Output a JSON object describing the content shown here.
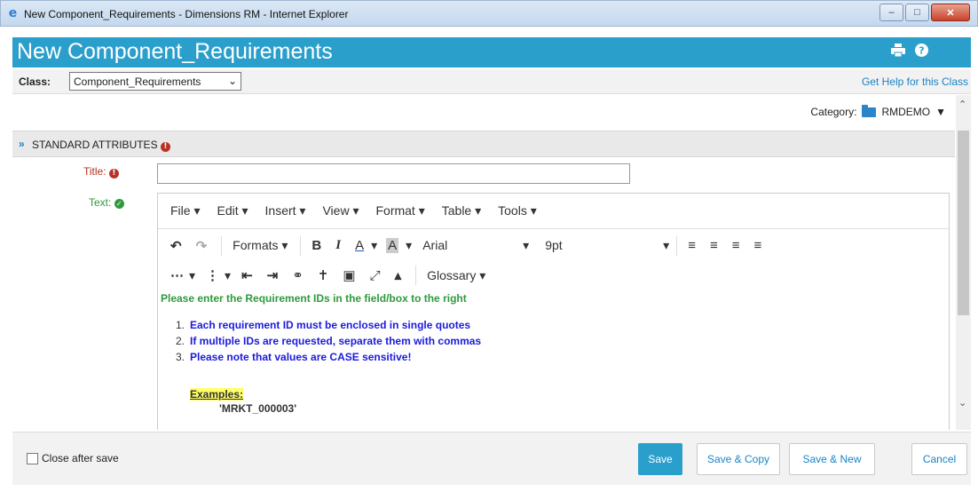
{
  "window": {
    "title": "New Component_Requirements - Dimensions RM - Internet Explorer",
    "minimize": "–",
    "maximize": "□",
    "close": "✕"
  },
  "header": {
    "title": "New Component_Requirements",
    "print_icon": "print-icon",
    "help_icon": "help-icon"
  },
  "class_row": {
    "label": "Class:",
    "selected": "Component_Requirements",
    "help_link": "Get Help for this Class"
  },
  "category": {
    "label": "Category:",
    "value": "RMDEMO"
  },
  "section": {
    "title": "STANDARD ATTRIBUTES"
  },
  "fields": {
    "title_label": "Title:",
    "title_value": "",
    "text_label": "Text:"
  },
  "editor": {
    "menus": [
      "File",
      "Edit",
      "Insert",
      "View",
      "Format",
      "Table",
      "Tools"
    ],
    "formats_label": "Formats",
    "font_name": "Arial",
    "font_size": "9pt",
    "glossary_label": "Glossary",
    "content": {
      "intro": "Please enter the Requirement IDs in the field/box to the right",
      "items": [
        {
          "num": "1.",
          "text": "Each requirement ID must be enclosed in single quotes"
        },
        {
          "num": "2.",
          "text": "If multiple IDs are requested, separate them with commas"
        },
        {
          "num": "3.",
          "text": "Please note that values are CASE sensitive!"
        }
      ],
      "examples_label": "Examples:",
      "example_value": "'MRKT_000003'"
    }
  },
  "footer": {
    "close_after_save": "Close after save",
    "save": "Save",
    "save_copy": "Save & Copy",
    "save_new": "Save & New",
    "cancel": "Cancel"
  },
  "colors": {
    "accent": "#2b9fcc",
    "required": "#b83224",
    "valid": "#2e9a3b",
    "instruction_blue": "#1a1adc"
  }
}
